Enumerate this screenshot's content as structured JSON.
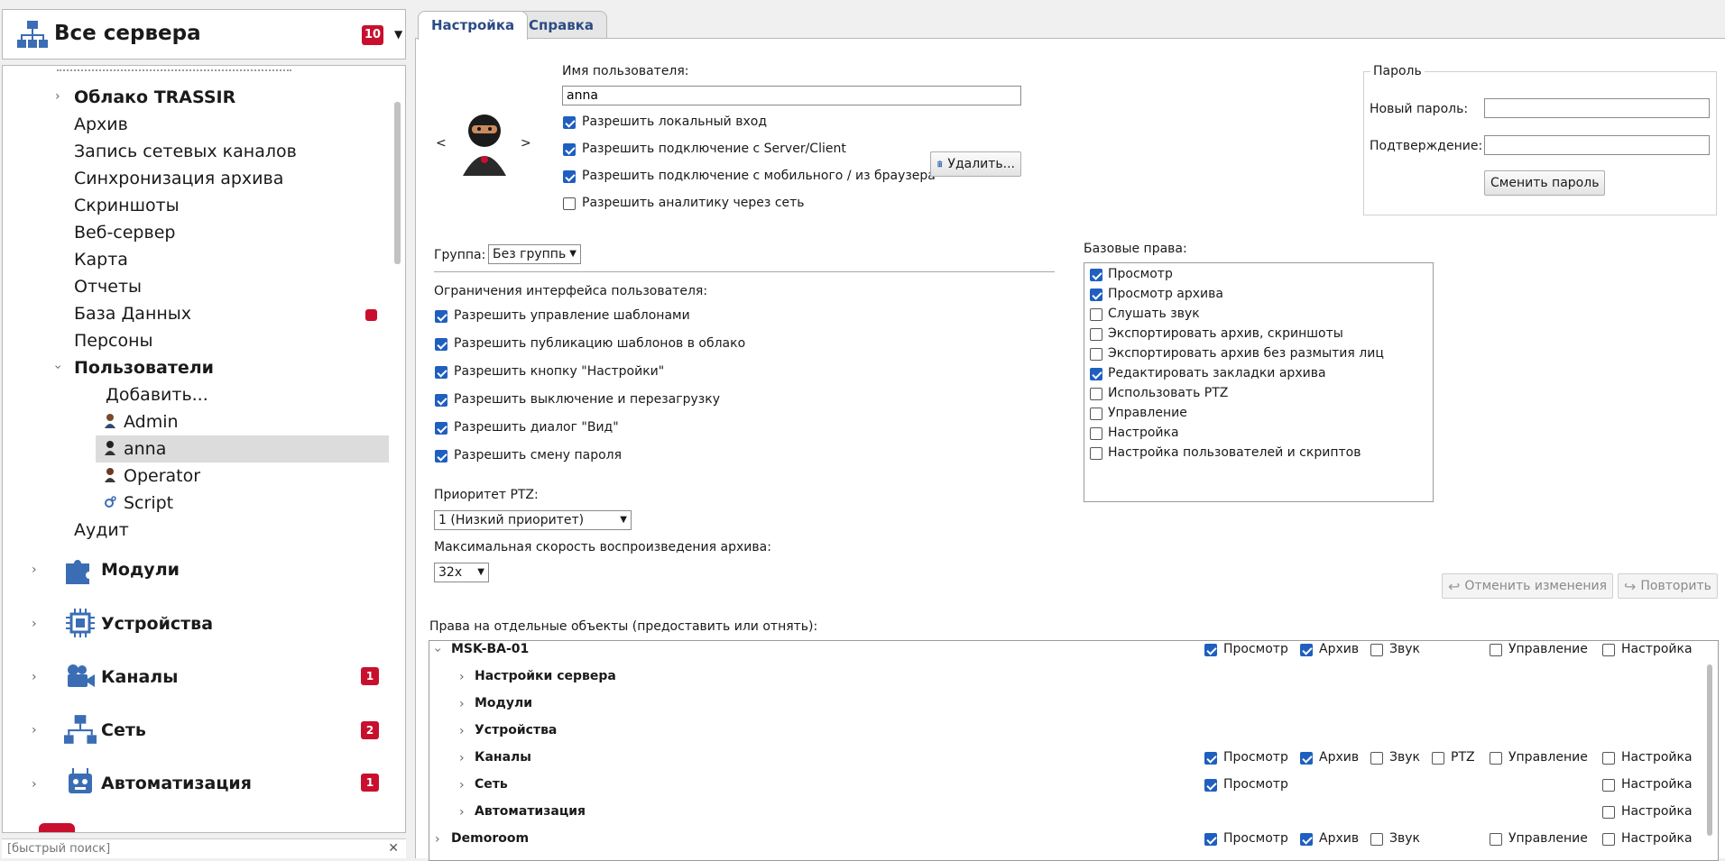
{
  "server_header": {
    "title": "Все сервера",
    "badge": "10"
  },
  "tree": {
    "items": [
      {
        "label": "Облако TRASSIR",
        "bold": true
      },
      {
        "label": "Архив"
      },
      {
        "label": "Запись сетевых каналов"
      },
      {
        "label": "Синхронизация архива"
      },
      {
        "label": "Скриншоты"
      },
      {
        "label": "Веб-сервер"
      },
      {
        "label": "Карта"
      },
      {
        "label": "Отчеты"
      },
      {
        "label": "База Данных"
      },
      {
        "label": "Персоны"
      },
      {
        "label": "Пользователи",
        "bold": true
      },
      {
        "label": "Добавить..."
      },
      {
        "label": "Admin"
      },
      {
        "label": "anna"
      },
      {
        "label": "Operator"
      },
      {
        "label": "Script"
      },
      {
        "label": "Аудит"
      }
    ],
    "sections": [
      {
        "label": "Модули",
        "badge": ""
      },
      {
        "label": "Устройства",
        "badge": ""
      },
      {
        "label": "Каналы",
        "badge": "1"
      },
      {
        "label": "Сеть",
        "badge": "2"
      },
      {
        "label": "Автоматизация",
        "badge": "1"
      }
    ]
  },
  "quick_search": {
    "placeholder": "[быстрый поиск]"
  },
  "tabs": {
    "settings": "Настройка",
    "help": "Справка"
  },
  "user": {
    "name_label": "Имя пользователя:",
    "name_value": "anna",
    "nav_prev": "<",
    "nav_next": ">",
    "checks": [
      {
        "label": "Разрешить локальный вход",
        "checked": true
      },
      {
        "label": "Разрешить подключение с Server/Client",
        "checked": true
      },
      {
        "label": "Разрешить подключение с мобильного / из браузера",
        "checked": true
      },
      {
        "label": "Разрешить аналитику через сеть",
        "checked": false
      }
    ],
    "delete_button": "Удалить..."
  },
  "password": {
    "title": "Пароль",
    "new_label": "Новый пароль:",
    "confirm_label": "Подтверждение:",
    "change_button": "Сменить пароль"
  },
  "group": {
    "label": "Группа:",
    "value": "Без группь"
  },
  "ui_limits": {
    "title": "Ограничения интерфейса пользователя:",
    "items": [
      {
        "label": "Разрешить управление шаблонами",
        "checked": true
      },
      {
        "label": "Разрешить публикацию шаблонов в облако",
        "checked": true
      },
      {
        "label": "Разрешить кнопку \"Настройки\"",
        "checked": true
      },
      {
        "label": "Разрешить выключение и перезагрузку",
        "checked": true
      },
      {
        "label": "Разрешить диалог \"Вид\"",
        "checked": true
      },
      {
        "label": "Разрешить смену пароля",
        "checked": true
      }
    ]
  },
  "ptz": {
    "label": "Приоритет PTZ:",
    "value": "1 (Низкий приоритет)"
  },
  "speed": {
    "label": "Максимальная скорость воспроизведения архива:",
    "value": "32x"
  },
  "base_rights": {
    "title": "Базовые права:",
    "items": [
      {
        "label": "Просмотр",
        "checked": true
      },
      {
        "label": "Просмотр архива",
        "checked": true
      },
      {
        "label": "Слушать звук",
        "checked": false
      },
      {
        "label": "Экспортировать архив, скриншоты",
        "checked": false
      },
      {
        "label": "Экспортировать архив без размытия лиц",
        "checked": false
      },
      {
        "label": "Редактировать закладки архива",
        "checked": true
      },
      {
        "label": "Использовать PTZ",
        "checked": false
      },
      {
        "label": "Управление",
        "checked": false
      },
      {
        "label": "Настройка",
        "checked": false
      },
      {
        "label": "Настройка пользователей и скриптов",
        "checked": false
      }
    ]
  },
  "actions": {
    "undo": "Отменить изменения",
    "redo": "Повторить"
  },
  "objects": {
    "title": "Права на отдельные объекты (предоставить или отнять):",
    "col_labels": {
      "view": "Просмотр",
      "archive": "Архив",
      "sound": "Звук",
      "ptz": "PTZ",
      "control": "Управление",
      "settings": "Настройка"
    },
    "rows": [
      {
        "label": "MSK-BA-01",
        "expanded": true,
        "view": true,
        "archive": true,
        "sound": false,
        "ptz": null,
        "control": false,
        "settings": false
      },
      {
        "label": "Настройки сервера",
        "view": null,
        "archive": null,
        "sound": null,
        "ptz": null,
        "control": null,
        "settings": null
      },
      {
        "label": "Модули",
        "view": null,
        "archive": null,
        "sound": null,
        "ptz": null,
        "control": null,
        "settings": null
      },
      {
        "label": "Устройства",
        "view": null,
        "archive": null,
        "sound": null,
        "ptz": null,
        "control": null,
        "settings": null
      },
      {
        "label": "Каналы",
        "view": true,
        "archive": true,
        "sound": false,
        "ptz": false,
        "control": false,
        "settings": false
      },
      {
        "label": "Сеть",
        "view": true,
        "archive": null,
        "sound": null,
        "ptz": null,
        "control": null,
        "settings": false
      },
      {
        "label": "Автоматизация",
        "view": null,
        "archive": null,
        "sound": null,
        "ptz": null,
        "control": null,
        "settings": false
      },
      {
        "label": "Demoroom",
        "expanded": false,
        "view": true,
        "archive": true,
        "sound": false,
        "ptz": null,
        "control": false,
        "settings": false
      }
    ]
  },
  "colors": {
    "accent": "#1f5fbf",
    "badge": "#c8102e",
    "tab_text": "#2c4b84"
  }
}
